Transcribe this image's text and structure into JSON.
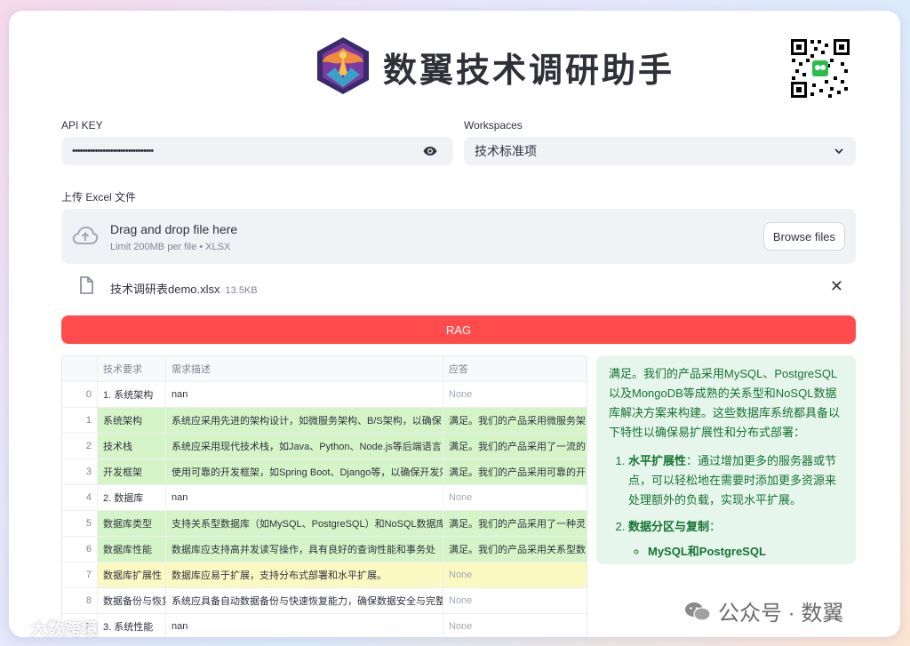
{
  "header": {
    "title": "数翼技术调研助手",
    "logo_icon": "phoenix-logo",
    "qr_icon": "qr-code"
  },
  "api_key": {
    "label": "API KEY",
    "masked_value": "••••••••••••••••••••••••••••••••",
    "toggle_icon": "eye-icon"
  },
  "workspaces": {
    "label": "Workspaces",
    "selected": "技术标准项"
  },
  "upload": {
    "label": "上传 Excel 文件",
    "drag_text": "Drag and drop file here",
    "limit_text": "Limit 200MB per file • XLSX",
    "browse_label": "Browse files",
    "file_name": "技术调研表demo.xlsx",
    "file_size": "13.5KB"
  },
  "rag_button": "RAG",
  "table": {
    "columns": [
      "",
      "技术要求",
      "需求描述",
      "应答"
    ],
    "rows": [
      {
        "idx": "0",
        "req": "1. 系统架构",
        "desc": "nan",
        "ans": "None",
        "hl": "none"
      },
      {
        "idx": "1",
        "req": "系统架构",
        "desc": "系统应采用先进的架构设计，如微服务架构、B/S架构，以确保",
        "ans": "满足。我们的产品采用微服务架",
        "hl": "green"
      },
      {
        "idx": "2",
        "req": "技术栈",
        "desc": "系统应采用现代技术栈，如Java、Python、Node.js等后端语言",
        "ans": "满足。我们的产品采用了一流的",
        "hl": "green"
      },
      {
        "idx": "3",
        "req": "开发框架",
        "desc": "使用可靠的开发框架，如Spring Boot、Django等，以确保开发效",
        "ans": "满足。我们的产品采用可靠的开",
        "hl": "green"
      },
      {
        "idx": "4",
        "req": "2. 数据库",
        "desc": "nan",
        "ans": "None",
        "hl": "none"
      },
      {
        "idx": "5",
        "req": "数据库类型",
        "desc": "支持关系型数据库（如MySQL、PostgreSQL）和NoSQL数据库",
        "ans": "满足。我们的产品采用了一种灵",
        "hl": "green"
      },
      {
        "idx": "6",
        "req": "数据库性能",
        "desc": "数据库应支持高并发读写操作，具有良好的查询性能和事务处",
        "ans": "满足。我们的产品采用关系型数",
        "hl": "green"
      },
      {
        "idx": "7",
        "req": "数据库扩展性",
        "desc": "数据库应易于扩展，支持分布式部署和水平扩展。",
        "ans": "None",
        "hl": "yellow"
      },
      {
        "idx": "8",
        "req": "数据备份与恢复",
        "desc": "系统应具备自动数据备份与快速恢复能力，确保数据安全与完整",
        "ans": "None",
        "hl": "none"
      },
      {
        "idx": "9",
        "req": "3. 系统性能",
        "desc": "nan",
        "ans": "None",
        "hl": "none"
      }
    ]
  },
  "answer_panel": {
    "intro": "满足。我们的产品采用MySQL、PostgreSQL以及MongoDB等成熟的关系型和NoSQL数据库解决方案来构建。这些数据库系统都具备以下特性以确保易扩展性和分布式部署：",
    "items": [
      {
        "title": "水平扩展性",
        "text": "：通过增加更多的服务器或节点，可以轻松地在需要时添加更多资源来处理额外的负载，实现水平扩展。"
      },
      {
        "title": "数据分区与复制",
        "text": "："
      }
    ],
    "sub_item": "MySQL和PostgreSQL"
  },
  "watermarks": {
    "right": "公众号 · 数翼",
    "left": "大数跨境"
  },
  "colors": {
    "primary_red": "#ff4b4b",
    "highlight_green": "#d5f5c8",
    "highlight_yellow": "#fbf9c2",
    "answer_bg": "#e6f6ec",
    "answer_text": "#177233"
  }
}
